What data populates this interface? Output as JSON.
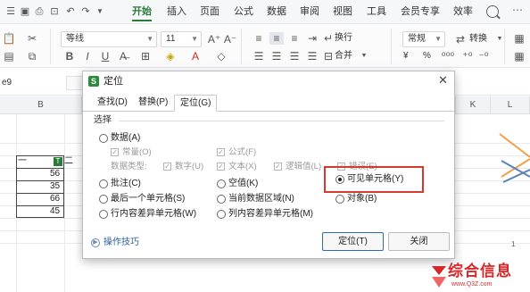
{
  "ribbon": {
    "tabs": [
      "开始",
      "插入",
      "页面",
      "公式",
      "数据",
      "审阅",
      "视图",
      "工具",
      "会员专享",
      "效率"
    ],
    "active_tab": "开始",
    "accent": "#2b7a3b"
  },
  "toolbar": {
    "font_name": "等线",
    "font_size": "11",
    "wrap_label": "换行",
    "merge_label": "合并",
    "number_format": "常规",
    "convert_label": "转换",
    "currency_symbol": "¥",
    "percent_symbol": "%"
  },
  "formula_bar": {
    "name_box": "e9"
  },
  "sheet": {
    "columns": [
      "B",
      "K",
      "L"
    ],
    "header_cell": "一",
    "header_cell2": "二",
    "filter_glyph": "T",
    "values": [
      "56",
      "35",
      "66",
      "45"
    ],
    "axis_label": "1"
  },
  "dialog": {
    "title": "定位",
    "logo_letter": "S",
    "tabs": [
      "查找(D)",
      "替换(P)",
      "定位(G)"
    ],
    "active_tab": "定位(G)",
    "group_label": "选择",
    "options": {
      "data": "数据(A)",
      "constants": "常量(O)",
      "formulas": "公式(F)",
      "data_type": "数据类型:",
      "numbers": "数字(U)",
      "text": "文本(X)",
      "logicals": "逻辑值(L)",
      "errors": "错误(E)",
      "comments": "批注(C)",
      "blanks": "空值(K)",
      "visible_cells": "可见单元格(Y)",
      "objects": "对象(B)",
      "last_cell": "最后一个单元格(S)",
      "current_region": "当前数据区域(N)",
      "row_diff": "行内容差异单元格(W)",
      "col_diff": "列内容差异单元格(M)"
    },
    "selected_option": "可见单元格(Y)",
    "highlight_color": "#d63a2f",
    "tips_label": "操作技巧",
    "ok_label": "定位(T)",
    "close_label": "关闭"
  },
  "watermark": {
    "text": "综合信息",
    "sub": "www.Q3Z.com"
  }
}
